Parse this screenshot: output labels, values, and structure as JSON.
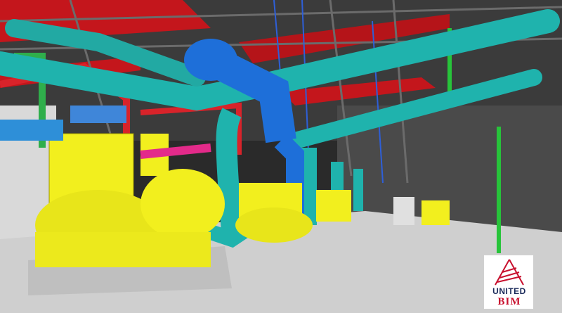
{
  "scene": {
    "subject": "chiller-plant-bim-model",
    "colors": {
      "chiller": "#f2ef1e",
      "chilled_water_pipe": "#1fb3ad",
      "condenser_pipe": "#1e6fd9",
      "hot_water_pipe": "#d8232a",
      "duct": "#2e8fd8",
      "floor": "#cfcfcf",
      "ceiling_steel": "#c4161c",
      "wall": "#3a3a3a"
    }
  },
  "logo": {
    "line1": "UNITED",
    "line2": "BIM",
    "colors": {
      "mark": "#c8102e",
      "text_dark": "#1a2a5a"
    }
  }
}
